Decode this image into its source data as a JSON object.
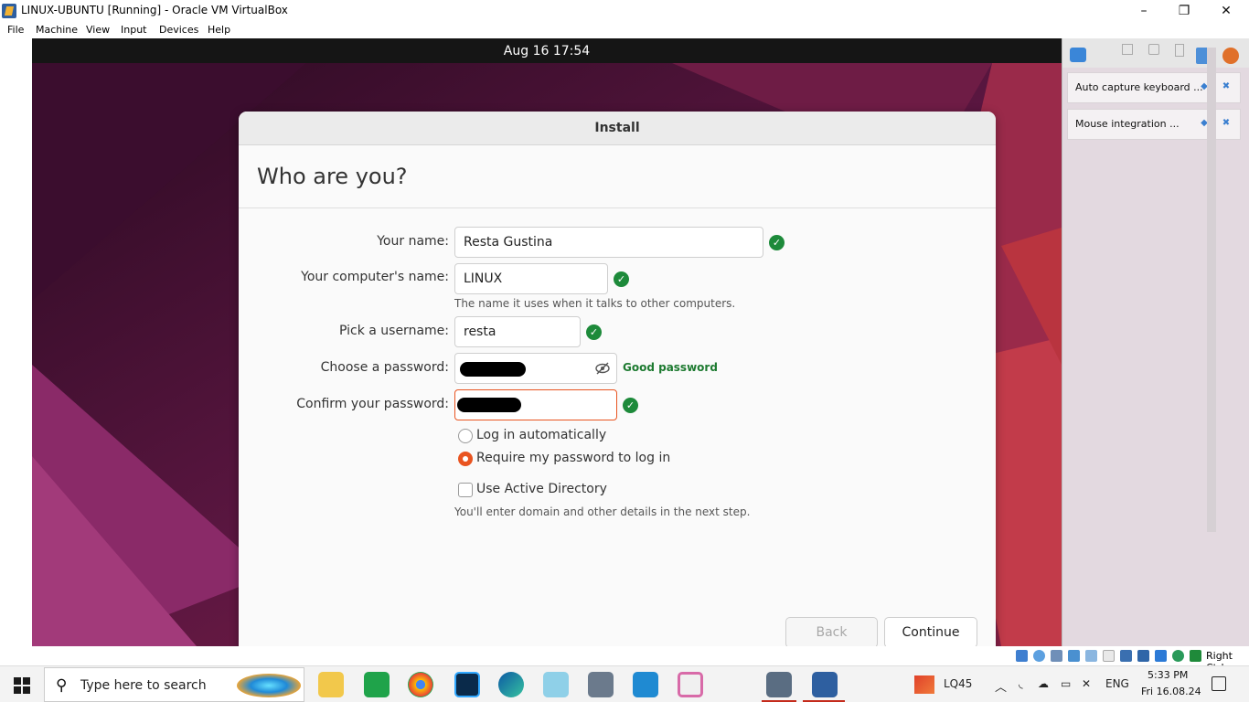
{
  "window": {
    "title": "LINUX-UBUNTU [Running] - Oracle VM VirtualBox",
    "minimize_glyph": "–",
    "restore_glyph": "❐",
    "close_glyph": "✕"
  },
  "menubar": {
    "items": [
      "File",
      "Machine",
      "View",
      "Input",
      "Devices",
      "Help"
    ]
  },
  "guest": {
    "topbar_clock": "Aug 16  17:54",
    "dialog": {
      "title": "Install",
      "heading": "Who are you?",
      "fields": {
        "name_label": "Your name:",
        "name_value": "Resta Gustina",
        "computer_label": "Your computer's name:",
        "computer_value": "LINUX",
        "computer_hint": "The name it uses when it talks to other computers.",
        "username_label": "Pick a username:",
        "username_value": "resta",
        "password_label": "Choose a password:",
        "password_strength": "Good password",
        "confirm_label": "Confirm your password:"
      },
      "login_options": {
        "auto_label": "Log in automatically",
        "require_label": "Require my password to log in",
        "selected": "require"
      },
      "active_directory": {
        "label": "Use Active Directory",
        "checked": false,
        "hint": "You'll enter domain and other details in the next step."
      },
      "buttons": {
        "back": "Back",
        "continue": "Continue"
      }
    }
  },
  "vbox_panel": {
    "notifications": [
      {
        "text": "Auto capture keyboard ..."
      },
      {
        "text": "Mouse integration ..."
      }
    ]
  },
  "statusbar": {
    "host_key": "Right Ctrl"
  },
  "taskbar": {
    "search_placeholder": "Type here to search",
    "stock_symbol": "LQ45",
    "language": "ENG",
    "time": "5:33 PM",
    "date": "Fri 16.08.24"
  },
  "colors": {
    "ubuntu_orange": "#e95420",
    "valid_green": "#1d8a3a"
  }
}
